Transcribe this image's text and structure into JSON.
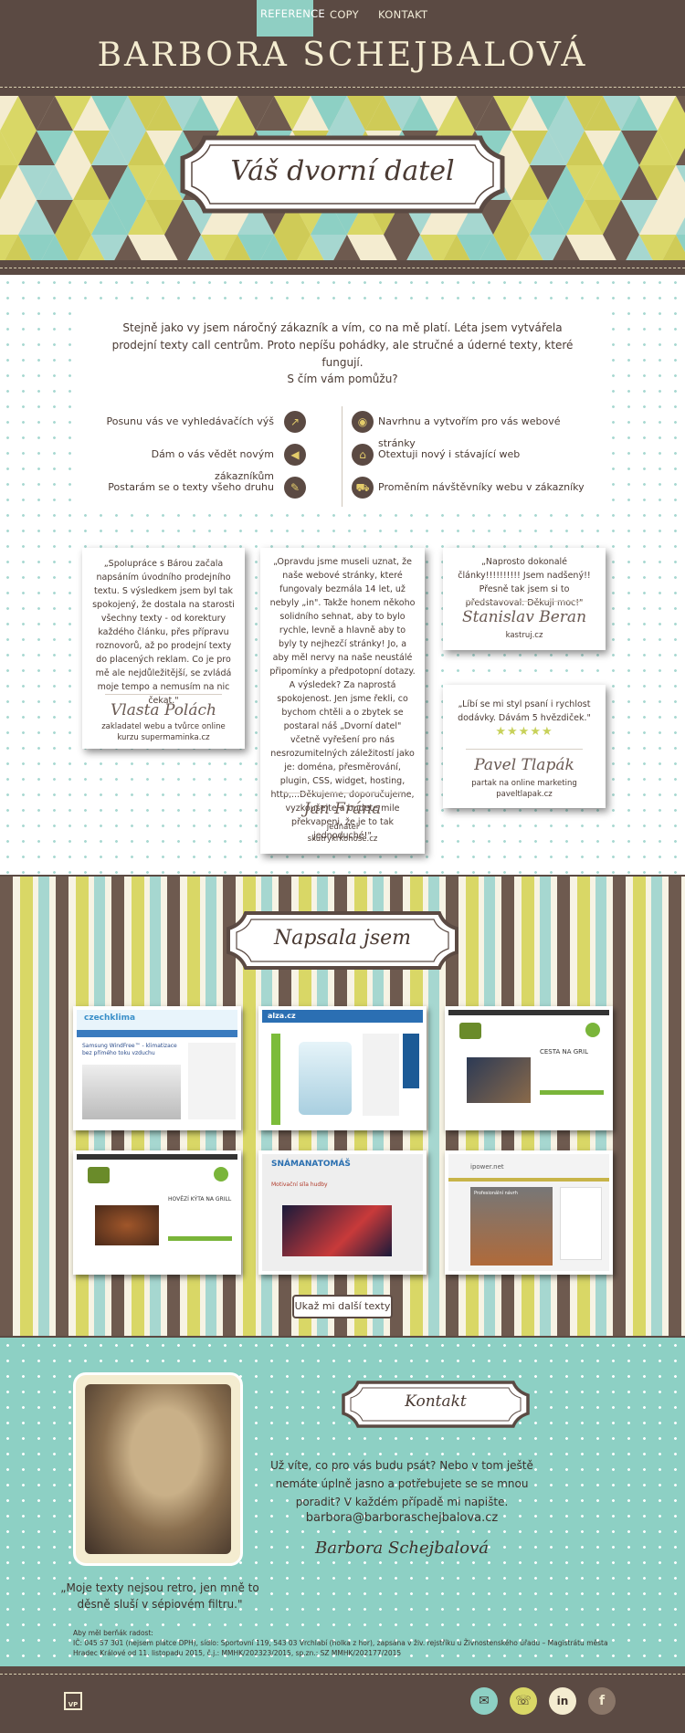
{
  "nav": {
    "items": [
      {
        "label": "REFERENCE",
        "active": true
      },
      {
        "label": "COPY",
        "active": false
      },
      {
        "label": "KONTAKT",
        "active": false
      }
    ]
  },
  "header": {
    "title": "BARBORA SCHEJBALOVÁ"
  },
  "hero": {
    "tagline": "Váš dvorní datel"
  },
  "intro": {
    "text": "Stejně jako vy jsem náročný zákazník a vím, co na mě platí. Léta jsem vytvářela prodejní texty call centrům. Proto nepíšu pohádky, ale stručné a úderné texty, které fungují.",
    "help_title": "S čím vám pomůžu?"
  },
  "services": {
    "left": [
      {
        "label": "Posunu vás ve vyhledávačích výš",
        "icon": "chart-icon"
      },
      {
        "label": "Dám o vás vědět novým zákazníkům",
        "icon": "megaphone-icon"
      },
      {
        "label": "Postarám se o texty všeho druhu",
        "icon": "pencil-icon"
      }
    ],
    "right": [
      {
        "label": "Navrhnu a vytvořím pro vás webové stránky",
        "icon": "eye-icon"
      },
      {
        "label": "Otextuji nový i stávající web",
        "icon": "home-icon"
      },
      {
        "label": "Proměním návštěvníky webu v zákazníky",
        "icon": "cart-icon"
      }
    ]
  },
  "testimonials": [
    {
      "quote": "„Spolupráce s Bárou začala napsáním úvodního prodejního textu. S výsledkem jsem byl tak spokojený, že dostala na starosti všechny texty - od korektury každého článku, přes přípravu roznovorů, až po prodejní texty do placených reklam. Co je pro mě ale nejdůležitější, se zvládá moje tempo a nemusím na nic čekat.\"",
      "name": "Vlasta Polách",
      "role": "zakladatel webu a tvůrce online kurzu supermaminka.cz"
    },
    {
      "quote": "„Opravdu jsme museli uznat, že naše webové stránky, které fungovaly bezmála 14 let, už nebyly „in\". Takže honem někoho solidního sehnat, aby to bylo rychle, levně a hlavně aby to byly ty nejhezčí stránky! Jo, a aby měl nervy na naše neustálé připomínky a předpotopní dotazy. A výsledek? Za naprostá spokojenost. Jen jsme řekli, co bychom chtěli a o zbytek se postaral náš „Dvorní datel\" včetně vyřešení pro nás nesrozumitelných záležitostí jako je: doména, přesměrování, plugin, CSS, widget, hosting, http,...Děkujeme, doporučujeme, vyzkoušejte a budete mile překvapeni, že je to tak jednoduché!\"",
      "name": "Jan Frána",
      "role_line1": "jednatel",
      "role_line2": "skutrykrkonose.cz"
    },
    {
      "quote": "„Naprosto dokonalé články!!!!!!!!!! Jsem nadšený!! Přesně tak jsem si to představoval. Děkuji moc!\"",
      "name": "Stanislav Beran",
      "role": "kastruj.cz"
    },
    {
      "quote": "„Líbí se mi styl psaní i rychlost dodávky. Dávám 5 hvězdiček.\"",
      "stars": "★★★★★",
      "rating": 5,
      "name": "Pavel Tlapák",
      "role_line1": "partak na online marketing",
      "role_line2": "paveltlapak.cz"
    }
  ],
  "portfolio": {
    "title": "Napsala jsem",
    "button": "Ukaž mi další texty",
    "shots": [
      {
        "name": "czechklima",
        "logo": "czechklima",
        "headline": "Samsung WindFree™ - klimatizace bez přímého toku vzduchu"
      },
      {
        "name": "alza",
        "logo": "alza.cz",
        "headline": ""
      },
      {
        "name": "grill-1",
        "logo": "",
        "headline": "CESTA NA GRIL"
      },
      {
        "name": "grill-2",
        "logo": "",
        "headline": "HOVĚZÍ KÝTA NA GRILL"
      },
      {
        "name": "snamanatomas",
        "logo": "SNÁMANATOMÁŠ",
        "headline": "Motivační síla hudby"
      },
      {
        "name": "ipower",
        "logo": "ipower.net",
        "headline": "Profesionální návrh"
      }
    ]
  },
  "contact": {
    "title": "Kontakt",
    "text": "Už víte, co pro vás budu psát? Nebo v tom ještě nemáte úplně jasno a potřebujete se se mnou poradit? V každém případě mi napište.",
    "email": "barbora@barboraschejbalova.cz",
    "signature": "Barbora Schejbalová",
    "photo_caption": "„Moje texty nejsou retro, jen mně to děsně sluší v sépiovém filtru.\"",
    "legal_line1": "Aby měl berňák radost:",
    "legal_line2": "IČ: 045 57 301 (nejsem plátce DPH), sídlo: Sportovní 119, 543 03 Vrchlabí (holka z hor), zapsána v živ. rejstříku u Živnostenského úřadu – Magistrátu města Hradec Králové od 11. listopadu 2015, č.j.: MMHK/202323/2015, sp.zn.: SZ MMHK/202177/2015"
  },
  "footer": {
    "logo": "VP",
    "social": [
      {
        "name": "email",
        "glyph": "✉"
      },
      {
        "name": "phone",
        "glyph": "☏"
      },
      {
        "name": "linkedin",
        "glyph": "in"
      },
      {
        "name": "facebook",
        "glyph": "f"
      }
    ]
  },
  "colors": {
    "brown": "#5b4a43",
    "teal": "#8dd0c4",
    "yellow": "#d9d766",
    "cream": "#f4ecd0"
  }
}
